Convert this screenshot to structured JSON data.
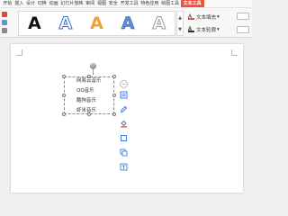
{
  "ribbon_tabs": {
    "items": [
      "开始",
      "插入",
      "设计",
      "切换",
      "动画",
      "幻灯片放映",
      "审阅",
      "视图",
      "安全",
      "开发工具",
      "特色应用",
      "绘图工具",
      "文本工具"
    ],
    "active_index": 12
  },
  "ribbon": {
    "text_styles": [
      {
        "glyph": "A",
        "style": "black"
      },
      {
        "glyph": "A",
        "style": "blue-outline"
      },
      {
        "glyph": "A",
        "style": "orange"
      },
      {
        "glyph": "A",
        "style": "blue-gradient"
      },
      {
        "glyph": "A",
        "style": "gray-outline"
      }
    ],
    "scroll_up": "▲",
    "scroll_down": "▼",
    "text_fill_label": "文本填充",
    "text_outline_label": "文本轮廓",
    "more_glyph": "▾"
  },
  "document": {
    "textbox_items": [
      "网易云音乐",
      "QQ音乐",
      "酷狗音乐",
      "虾米音乐"
    ],
    "rotate_glyph": "⟳"
  },
  "floating_toolbar": {
    "collapse_glyph": "−"
  },
  "colors": {
    "accent": "#e8543a",
    "text_fill_icon": "#e74c3c",
    "toolbar_icon": "#2f6fd6"
  }
}
